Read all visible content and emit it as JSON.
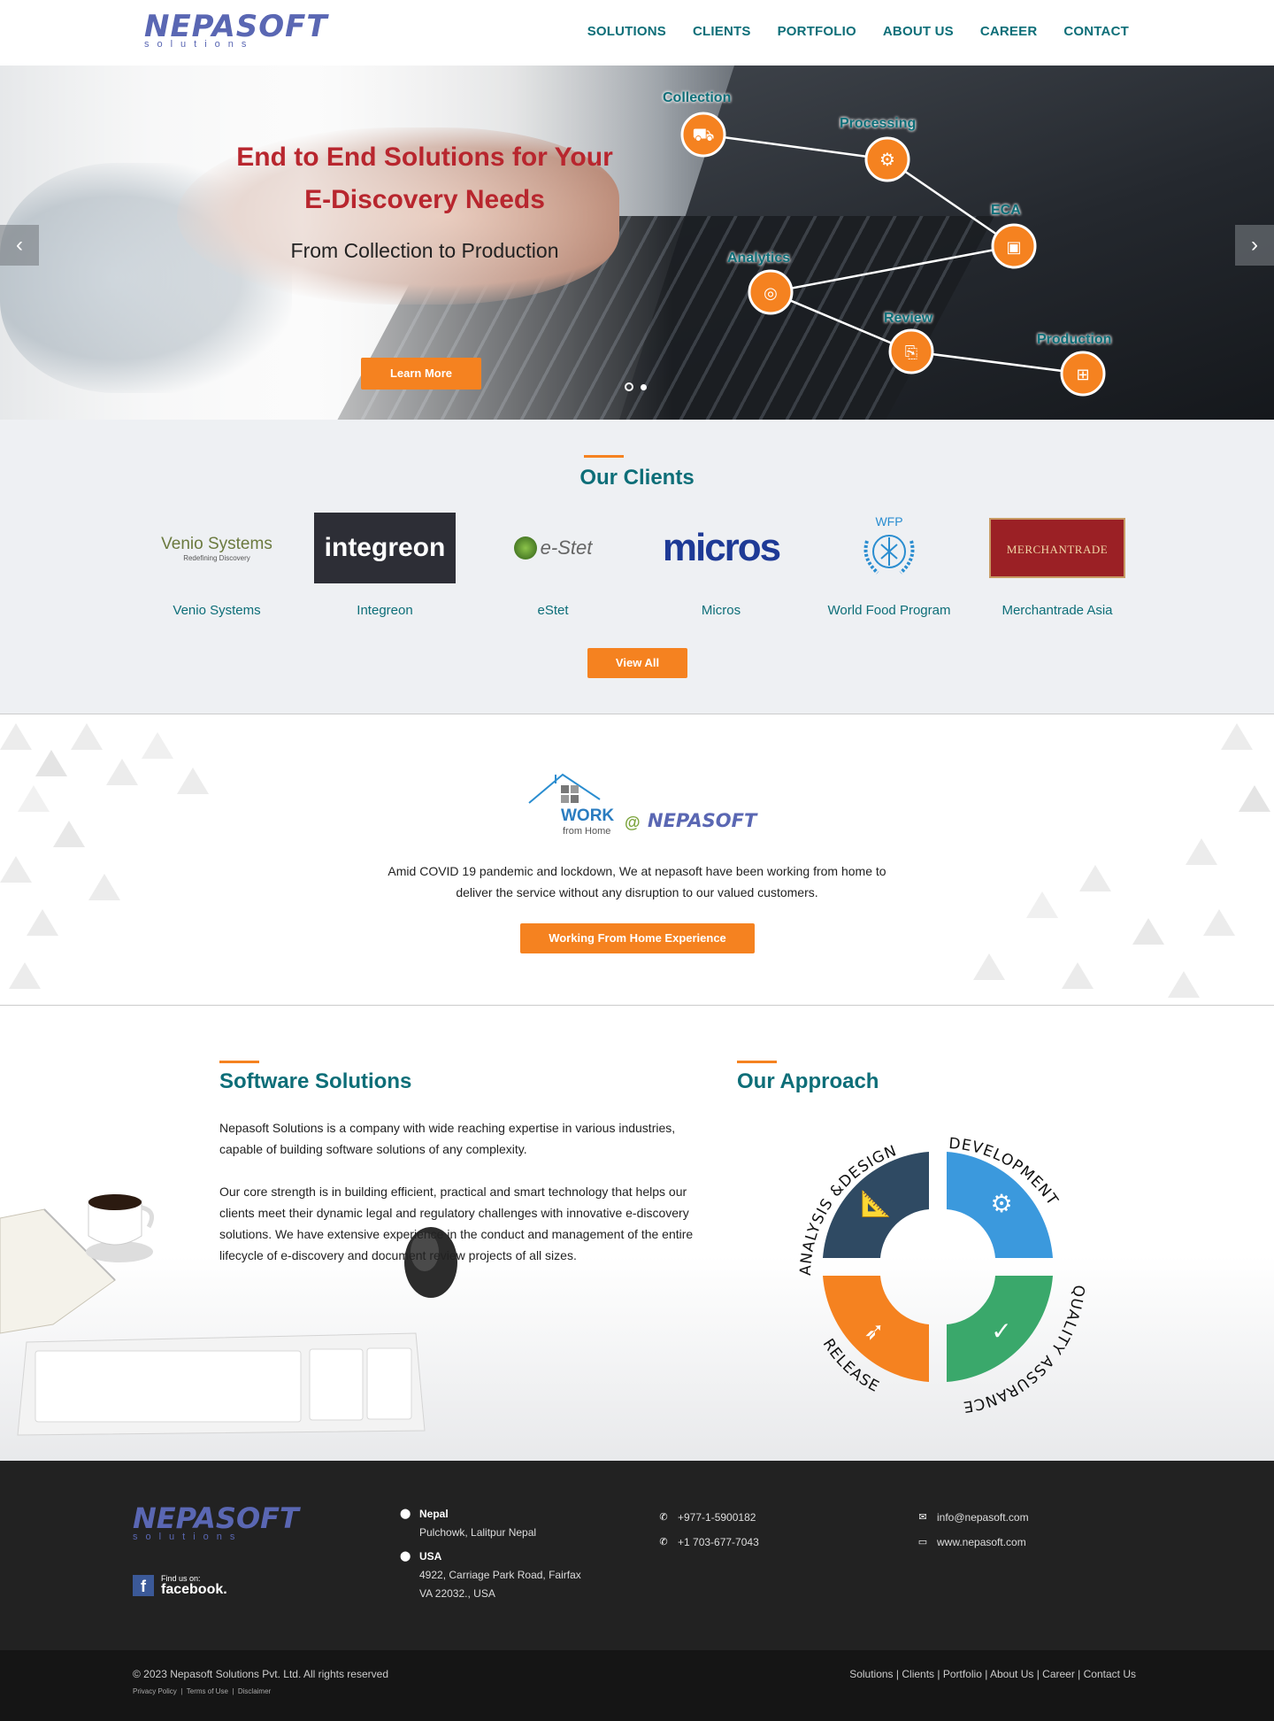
{
  "header": {
    "logo_top": "NEPASOFT",
    "logo_bottom": "solutions",
    "nav": [
      "SOLUTIONS",
      "CLIENTS",
      "PORTFOLIO",
      "ABOUT US",
      "CAREER",
      "CONTACT"
    ]
  },
  "hero": {
    "title_line1": "End to End Solutions for Your",
    "title_line2": "E-Discovery Needs",
    "subtitle": "From Collection to Production",
    "cta": "Learn More",
    "stages": [
      "Collection",
      "Processing",
      "ECA",
      "Analytics",
      "Review",
      "Production"
    ],
    "prev_arrow": "‹",
    "next_arrow": "›"
  },
  "clients": {
    "title": "Our Clients",
    "items": [
      {
        "name": "Venio Systems",
        "logo": "Venio Systems",
        "tagline": "Redefining Discovery"
      },
      {
        "name": "Integreon",
        "logo": "integreon"
      },
      {
        "name": "eStet",
        "logo": "e-Stet"
      },
      {
        "name": "Micros",
        "logo": "micros"
      },
      {
        "name": "World Food Program",
        "logo": "WFP"
      },
      {
        "name": "Merchantrade Asia",
        "logo": "MERCHANTRADE"
      }
    ],
    "cta": "View All"
  },
  "wfh": {
    "logo_work": "WORK",
    "logo_home": "from Home",
    "logo_at": "@",
    "logo_brand": "NEPASOFT",
    "text": "Amid COVID 19 pandemic and lockdown, We at nepasoft have been working from home to deliver the service without any disruption to our valued customers.",
    "cta": "Working From Home Experience"
  },
  "software": {
    "title": "Software Solutions",
    "p1": "Nepasoft Solutions is a company with wide reaching expertise in various industries, capable of building software solutions of any complexity.",
    "p2": "Our core strength is in building efficient, practical and smart technology that helps our clients meet their dynamic legal and regulatory challenges with innovative e-discovery solutions. We have extensive experience in the conduct and management of the entire lifecycle of e-discovery and document review projects of all sizes."
  },
  "approach": {
    "title": "Our Approach",
    "segments": [
      "ANALYSIS &DESIGN",
      "DEVELOPMENT",
      "QUALITY ASSURANCE",
      "RELEASE"
    ],
    "colors": [
      "#2f4a63",
      "#3b99dd",
      "#3aa86b",
      "#f58220"
    ]
  },
  "footer": {
    "logo_top": "NEPASOFT",
    "logo_bottom": "solutions",
    "fb_small": "Find us on:",
    "fb_big": "facebook.",
    "nepal_title": "Nepal",
    "nepal_addr": "Pulchowk, Lalitpur Nepal",
    "usa_title": "USA",
    "usa_addr1": "4922, Carriage Park Road, Fairfax",
    "usa_addr2": "VA 22032., USA",
    "phone1": "+977-1-5900182",
    "phone2": "+1 703-677-7043",
    "email": "info@nepasoft.com",
    "web": "www.nepasoft.com"
  },
  "bottom": {
    "copyright": "© 2023 Nepasoft Solutions Pvt. Ltd. All rights reserved",
    "legal": [
      "Privacy Policy",
      "Terms of Use",
      "Disclaimer"
    ],
    "links": [
      "Solutions",
      "Clients",
      "Portfolio",
      "About Us",
      "Career",
      "Contact Us"
    ]
  },
  "colors": {
    "teal": "#0d6e78",
    "orange": "#f58220",
    "red": "#b8262e",
    "brand": "#5a67b3"
  }
}
